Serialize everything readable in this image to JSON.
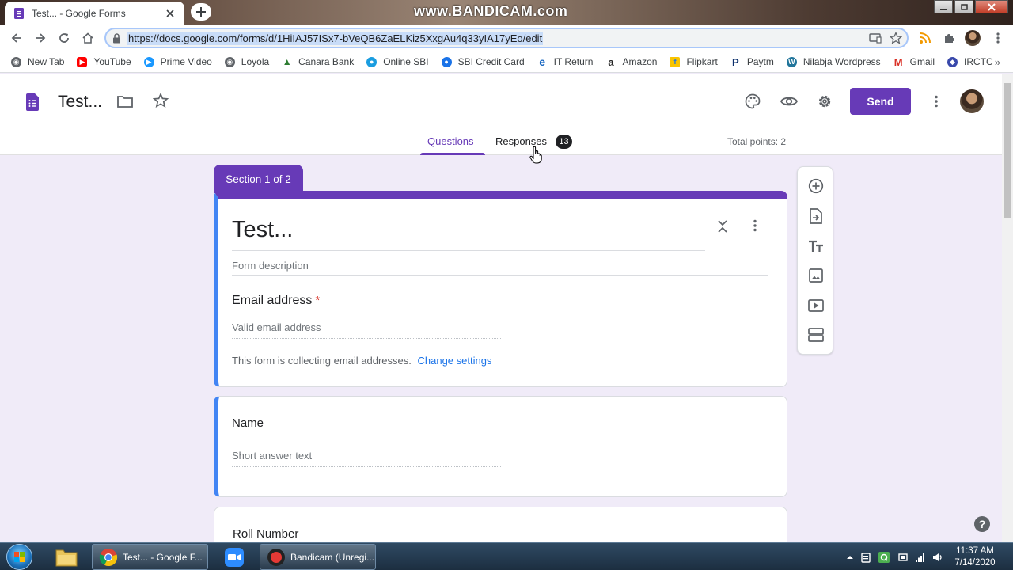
{
  "browser": {
    "tab_title": "Test... - Google Forms",
    "url": "https://docs.google.com/forms/d/1HiIAJ57ISx7-bVeQB6ZaELKiz5XxgAu4q33yIA17yEo/edit",
    "watermark": "www.BANDICAM.com",
    "bookmarks": [
      {
        "label": "New Tab",
        "icon": "globe-icon",
        "color": "#5f6368"
      },
      {
        "label": "YouTube",
        "icon": "youtube-icon",
        "color": "#ff0000"
      },
      {
        "label": "Prime Video",
        "icon": "prime-video-icon",
        "color": "#1a98ff"
      },
      {
        "label": "Loyola",
        "icon": "globe-icon",
        "color": "#5f6368"
      },
      {
        "label": "Canara Bank",
        "icon": "canara-icon",
        "color": "#2e7d32"
      },
      {
        "label": "Online SBI",
        "icon": "sbi-icon",
        "color": "#1a73e8"
      },
      {
        "label": "SBI Credit Card",
        "icon": "sbi-card-icon",
        "color": "#1a73e8"
      },
      {
        "label": "IT Return",
        "icon": "ie-icon",
        "color": "#1565c0"
      },
      {
        "label": "Amazon",
        "icon": "amazon-icon",
        "color": "#222222"
      },
      {
        "label": "Flipkart",
        "icon": "flipkart-icon",
        "color": "#f9c400"
      },
      {
        "label": "Paytm",
        "icon": "paytm-icon",
        "color": "#0b2f6b"
      },
      {
        "label": "Nilabja Wordpress",
        "icon": "wordpress-icon",
        "color": "#21759b"
      },
      {
        "label": "Gmail",
        "icon": "gmail-icon",
        "color": "#d93025"
      },
      {
        "label": "IRCTC",
        "icon": "irctc-icon",
        "color": "#3949ab"
      }
    ]
  },
  "forms": {
    "doc_title": "Test...",
    "send_label": "Send",
    "tabs": {
      "questions": "Questions",
      "responses": "Responses",
      "responses_count": "13"
    },
    "total_points": "Total points: 2",
    "section_label": "Section 1 of 2",
    "form_title": "Test...",
    "form_description_placeholder": "Form description",
    "email_question": {
      "label": "Email address",
      "required_mark": "*",
      "placeholder": "Valid email address"
    },
    "collect_note": "This form is collecting email addresses.",
    "change_settings": "Change settings",
    "name_question": {
      "label": "Name",
      "placeholder": "Short answer text"
    },
    "roll_question": {
      "label": "Roll Number"
    },
    "accent_color": "#673ab7",
    "focus_color": "#4285f4"
  },
  "taskbar": {
    "chrome_item": "Test... - Google F...",
    "bandicam_item": "Bandicam (Unregi...",
    "time": "11:37 AM",
    "date": "7/14/2020"
  }
}
